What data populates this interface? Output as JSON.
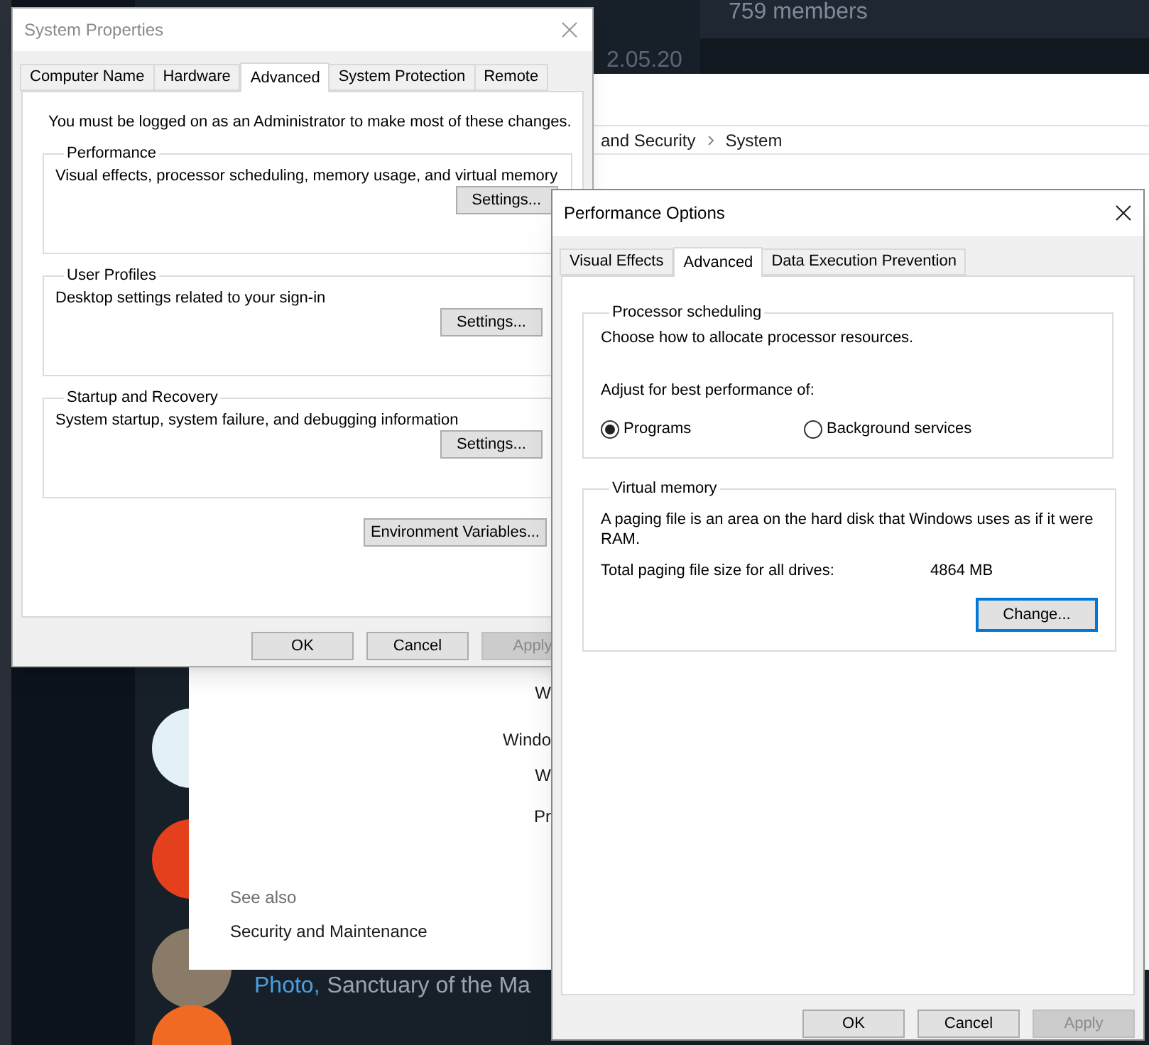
{
  "background_app": {
    "member_count": "759 members",
    "timestamp": "2.05.20",
    "avatars": [
      {
        "kind": "logo",
        "color": "#e3f1f7"
      },
      {
        "kind": "logo",
        "color": "#e5401d"
      },
      {
        "kind": "photo"
      },
      {
        "kind": "logo",
        "color": "#f06a24"
      }
    ],
    "post": {
      "link": "Photo,",
      "text": "Sanctuary of the Ma"
    }
  },
  "control_panel": {
    "breadcrumb": [
      "and Security",
      "System"
    ],
    "fragments": [
      "W",
      "Windo",
      "W",
      "Pr"
    ],
    "see_also": {
      "heading": "See also",
      "links": [
        "Security and Maintenance"
      ]
    }
  },
  "system_properties": {
    "title": "System Properties",
    "tabs": [
      {
        "label": "Computer Name",
        "selected": false
      },
      {
        "label": "Hardware",
        "selected": false
      },
      {
        "label": "Advanced",
        "selected": true
      },
      {
        "label": "System Protection",
        "selected": false
      },
      {
        "label": "Remote",
        "selected": false
      }
    ],
    "notice": "You must be logged on as an Administrator to make most of these changes.",
    "groups": [
      {
        "title": "Performance",
        "description": "Visual effects, processor scheduling, memory usage, and virtual memory",
        "button": "Settings..."
      },
      {
        "title": "User Profiles",
        "description": "Desktop settings related to your sign-in",
        "button": "Settings..."
      },
      {
        "title": "Startup and Recovery",
        "description": "System startup, system failure, and debugging information",
        "button": "Settings..."
      }
    ],
    "environment_button": "Environment Variables...",
    "buttons": [
      {
        "label": "OK",
        "disabled": false
      },
      {
        "label": "Cancel",
        "disabled": false
      },
      {
        "label": "Apply",
        "disabled": true
      }
    ]
  },
  "performance_options": {
    "title": "Performance Options",
    "tabs": [
      {
        "label": "Visual Effects",
        "selected": false
      },
      {
        "label": "Advanced",
        "selected": true
      },
      {
        "label": "Data Execution Prevention",
        "selected": false
      }
    ],
    "processor_scheduling": {
      "title": "Processor scheduling",
      "description": "Choose how to allocate processor resources.",
      "prompt": "Adjust for best performance of:",
      "options": [
        {
          "label": "Programs",
          "selected": true
        },
        {
          "label": "Background services",
          "selected": false
        }
      ]
    },
    "virtual_memory": {
      "title": "Virtual memory",
      "description": "A paging file is an area on the hard disk that Windows uses as if it were RAM.",
      "total_label": "Total paging file size for all drives:",
      "total_value": "4864 MB",
      "button": {
        "label": "Change...",
        "focused": true
      }
    },
    "buttons": [
      {
        "label": "OK",
        "disabled": false
      },
      {
        "label": "Cancel",
        "disabled": false
      },
      {
        "label": "Apply",
        "disabled": true
      }
    ]
  }
}
